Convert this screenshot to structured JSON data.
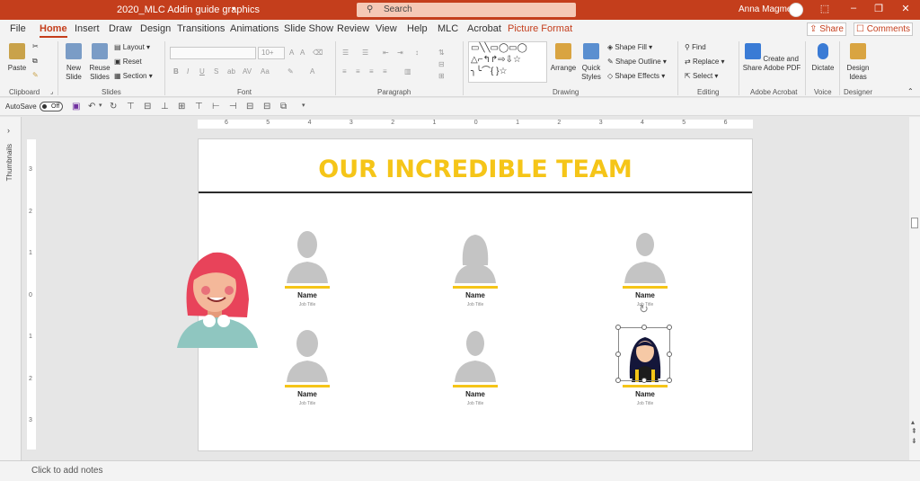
{
  "window": {
    "title": "2020_MLC Addin guide graphics",
    "search_placeholder": "Search",
    "user_name": "Anna Magmel",
    "controls": [
      "⬚",
      "–",
      "❐",
      "✕"
    ]
  },
  "tabs": [
    "File",
    "Home",
    "Insert",
    "Draw",
    "Design",
    "Transitions",
    "Animations",
    "Slide Show",
    "Review",
    "View",
    "Help",
    "MLC",
    "Acrobat",
    "Picture Format"
  ],
  "actions": {
    "share": "Share",
    "comments": "Comments"
  },
  "ribbon": {
    "clipboard": {
      "paste": "Paste",
      "label": "Clipboard"
    },
    "slides": {
      "new_slide": "New Slide",
      "reuse_slides": "Reuse Slides",
      "layout": "Layout",
      "reset": "Reset",
      "section": "Section",
      "label": "Slides"
    },
    "font": {
      "font_size": "10+",
      "label": "Font",
      "buttons": [
        "B",
        "I",
        "U",
        "S",
        "ab",
        "AV",
        "Aa",
        "A",
        "A"
      ]
    },
    "paragraph": {
      "label": "Paragraph"
    },
    "drawing": {
      "arrange": "Arrange",
      "quick_styles": "Quick Styles",
      "shape_fill": "Shape Fill",
      "shape_outline": "Shape Outline",
      "shape_effects": "Shape Effects",
      "label": "Drawing"
    },
    "editing": {
      "find": "Find",
      "replace": "Replace",
      "select": "Select",
      "label": "Editing"
    },
    "acrobat": {
      "create_share": "Create and Share Adobe PDF",
      "label": "Adobe Acrobat"
    },
    "voice": {
      "dictate": "Dictate",
      "label": "Voice"
    },
    "designer": {
      "design_ideas": "Design Ideas",
      "label": "Designer"
    }
  },
  "qat": {
    "autosave": "AutoSave",
    "toggle": "Off"
  },
  "thumbnails_label": "Thumbnails",
  "ruler": {
    "h_labels": [
      "6",
      "5",
      "4",
      "3",
      "2",
      "1",
      "0",
      "1",
      "2",
      "3",
      "4",
      "5",
      "6"
    ],
    "v_labels": [
      "3",
      "2",
      "1",
      "0",
      "1",
      "2",
      "3"
    ]
  },
  "slide": {
    "title": "OUR INCREDIBLE TEAM",
    "members": [
      {
        "name": "Name",
        "job": "Job Title"
      },
      {
        "name": "Name",
        "job": "Job Title"
      },
      {
        "name": "Name",
        "job": "Job Title"
      },
      {
        "name": "Name",
        "job": "Job Title"
      },
      {
        "name": "Name",
        "job": "Job Title"
      },
      {
        "name": "Name",
        "job": "Job Title"
      }
    ]
  },
  "notes_placeholder": "Click to add notes",
  "colors": {
    "accent": "#c43e1c",
    "title_yellow": "#f5c518",
    "silhouette": "#c4c4c4"
  }
}
